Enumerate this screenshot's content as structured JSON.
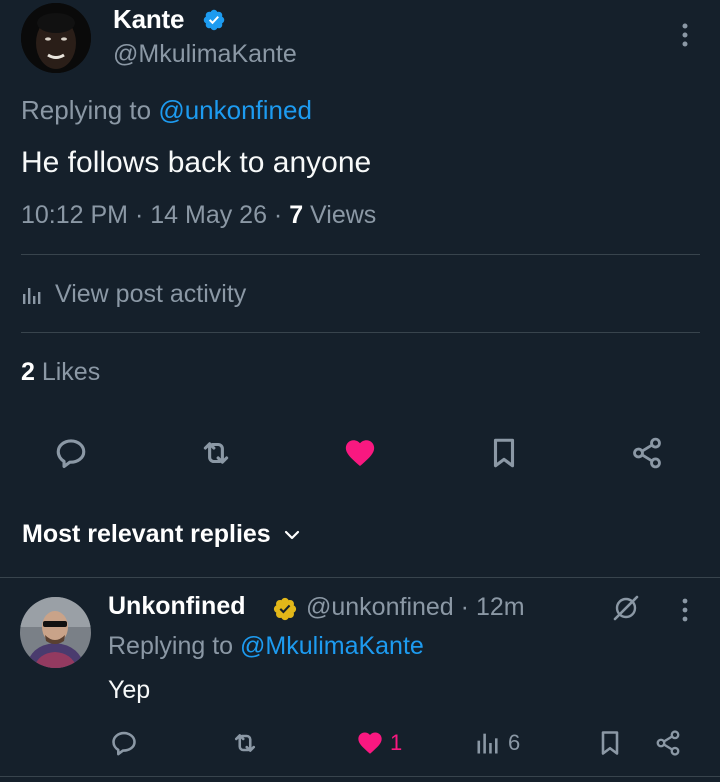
{
  "tweet": {
    "author_name": "Kante",
    "author_handle": "@MkulimaKante",
    "replying_prefix": "Replying to ",
    "replying_to": "@unkonfined",
    "text": "He follows back to anyone",
    "time": "10:12 PM",
    "date": "14 May 26",
    "separator": " · ",
    "views_count": "7",
    "views_label": " Views",
    "post_activity_label": "View post activity",
    "likes_count": "2",
    "likes_label": " Likes",
    "liked": true
  },
  "replies_section": {
    "title": "Most relevant replies"
  },
  "reply": {
    "author_name": "Unkonfined",
    "author_handle": "@unkonfined",
    "age": "12m",
    "replying_prefix": "Replying to ",
    "replying_to": "@MkulimaKante",
    "text": "Yep",
    "like_count": "1",
    "view_count": "6"
  },
  "colors": {
    "background": "#15202b",
    "accent_blue": "#1d9bf0",
    "like_pink": "#f91880",
    "muted": "#8b98a5",
    "verified_gold": "#e2b719"
  },
  "icons": [
    "verified-badge-icon",
    "more-icon",
    "post-activity-icon",
    "reply-icon",
    "retweet-icon",
    "heart-icon",
    "bookmark-icon",
    "share-icon",
    "chevron-down-icon",
    "grok-icon",
    "views-icon"
  ]
}
